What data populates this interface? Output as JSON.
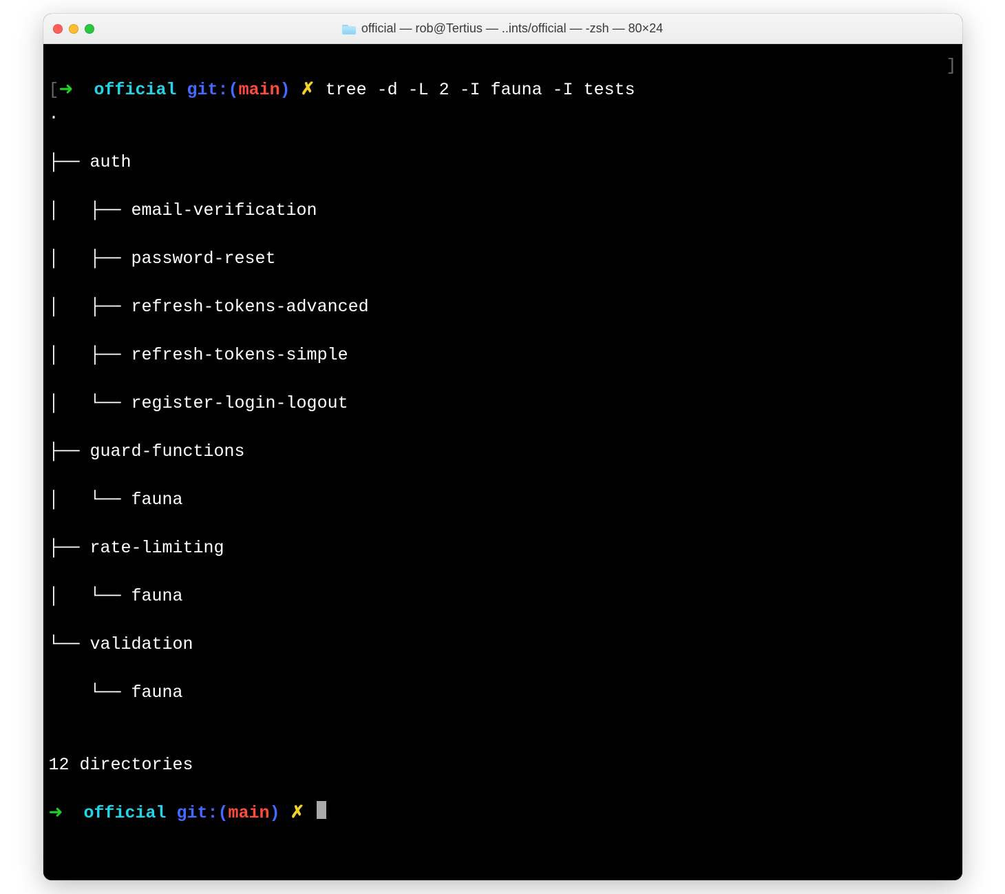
{
  "window": {
    "title": "official — rob@Tertius — ..ints/official — -zsh — 80×24"
  },
  "prompt": {
    "arrow": "➜",
    "dir": "official",
    "git_prefix": "git:",
    "lparen": "(",
    "branch": "main",
    "rparen": ")",
    "dirty": "✗"
  },
  "command": "tree -d -L 2 -I fauna -I tests",
  "output_lines": [
    ".",
    "├── auth",
    "│   ├── email-verification",
    "│   ├── password-reset",
    "│   ├── refresh-tokens-advanced",
    "│   ├── refresh-tokens-simple",
    "│   └── register-login-logout",
    "├── guard-functions",
    "│   └── fauna",
    "├── rate-limiting",
    "│   └── fauna",
    "└── validation",
    "    └── fauna",
    "",
    "12 directories"
  ]
}
